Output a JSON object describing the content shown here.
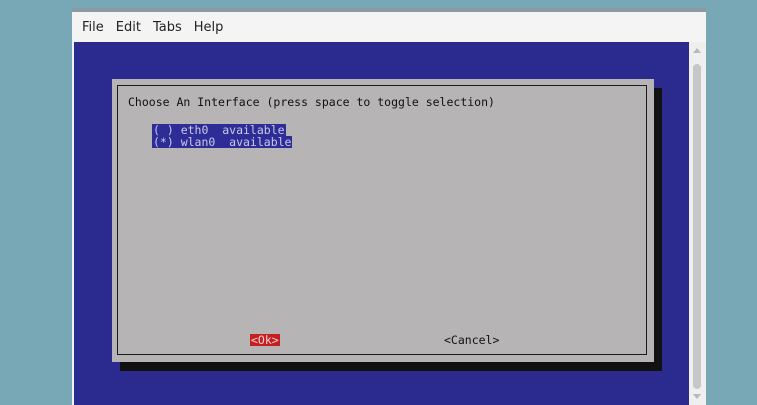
{
  "menubar": {
    "items": [
      "File",
      "Edit",
      "Tabs",
      "Help"
    ]
  },
  "dialog": {
    "title": "Choose An Interface (press space to toggle selection)",
    "options": [
      {
        "label": "( ) eth0  available"
      },
      {
        "label": "(*) wlan0  available"
      }
    ],
    "ok_label": "<Ok>",
    "cancel_label": "<Cancel>"
  },
  "colors": {
    "terminal_bg": "#2b2a8f",
    "dialog_bg": "#b6b4b4",
    "selection_bg": "#2e2d97",
    "ok_highlight": "#c61f1f",
    "desktop_bg": "#78a8b5"
  },
  "icons": {
    "scroll_up": "scroll-up-arrow-icon",
    "scroll_down": "scroll-down-arrow-icon"
  }
}
